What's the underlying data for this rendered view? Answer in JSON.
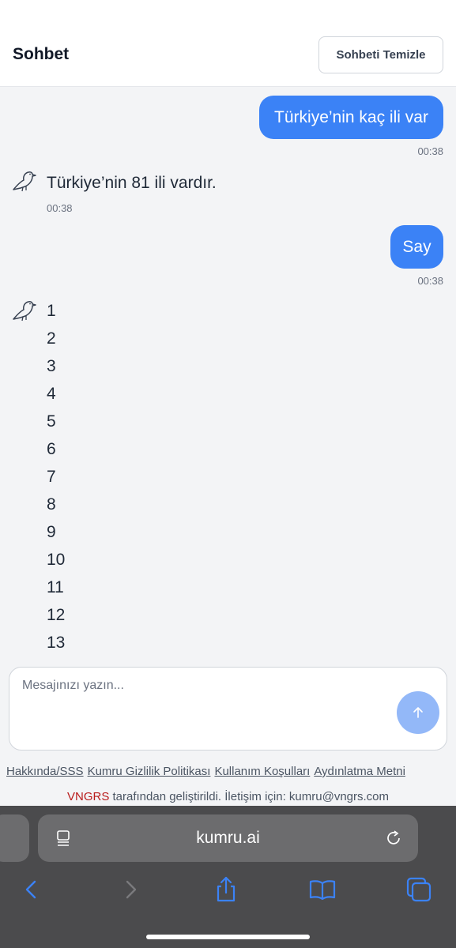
{
  "header": {
    "title": "Sohbet",
    "clear_label": "Sohbeti Temizle"
  },
  "messages": {
    "user1": {
      "text": "Türkiye’nin kaç ili var",
      "time": "00:38"
    },
    "bot1": {
      "text": "Türkiye’nin 81 ili vardır.",
      "time": "00:38"
    },
    "user2": {
      "text": "Say",
      "time": "00:38"
    },
    "bot2": {
      "lines": [
        "1",
        "2",
        "3",
        "4",
        "5",
        "6",
        "7",
        "8",
        "9",
        "10",
        "11",
        "12",
        "13"
      ]
    }
  },
  "input": {
    "placeholder": "Mesajınızı yazın..."
  },
  "footer": {
    "links": [
      "Hakkında/SSS",
      "Kumru Gizlilik Politikası",
      "Kullanım Koşulları",
      "Aydınlatma Metni"
    ],
    "brand": "VNGRS",
    "credit": " tarafından geliştirildi. İletişim için: kumru@vngrs.com"
  },
  "browser": {
    "url": "kumru.ai"
  },
  "colors": {
    "accent": "#3b82f6",
    "send_disabled": "#93b8f8",
    "brand": "#b91c1c"
  },
  "icons": [
    "bird-avatar-icon",
    "arrow-up-icon",
    "reader-icon",
    "reload-icon",
    "back-icon",
    "forward-icon",
    "share-icon",
    "bookmarks-icon",
    "tabs-icon"
  ]
}
